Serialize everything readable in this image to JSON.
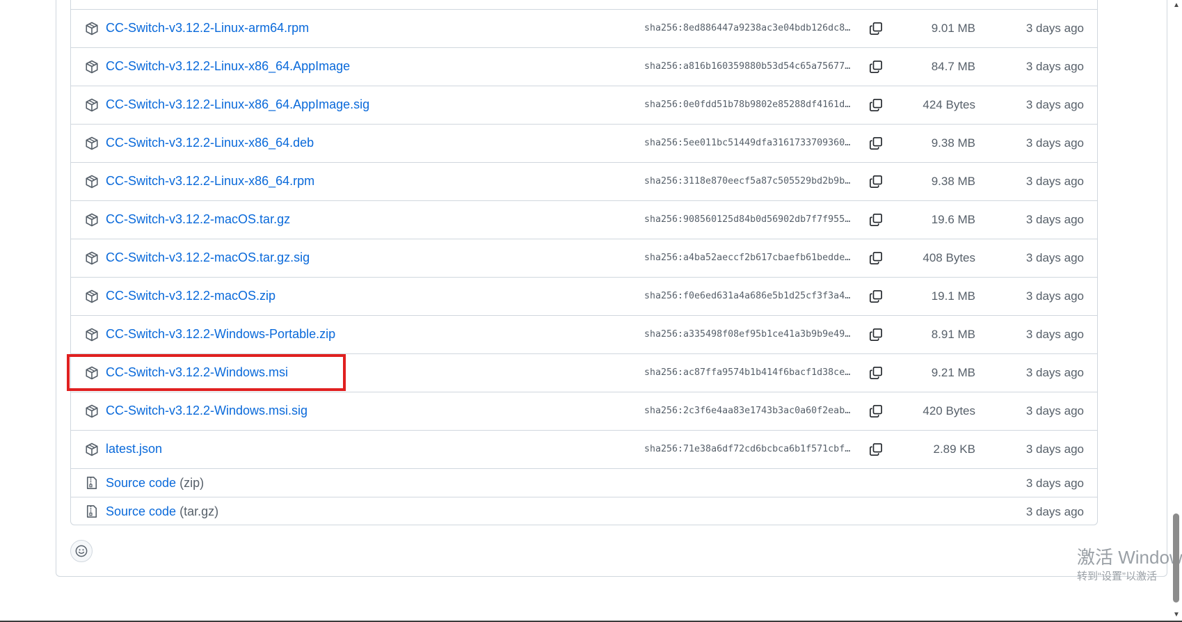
{
  "assets": [
    {
      "name": "CC-Switch-v3.12.2-Linux-arm64.rpm",
      "sha": "sha256:8ed886447a9238ac3e04bdb126dc8…",
      "size": "9.01 MB",
      "date": "3 days ago"
    },
    {
      "name": "CC-Switch-v3.12.2-Linux-x86_64.AppImage",
      "sha": "sha256:a816b160359880b53d54c65a75677…",
      "size": "84.7 MB",
      "date": "3 days ago"
    },
    {
      "name": "CC-Switch-v3.12.2-Linux-x86_64.AppImage.sig",
      "sha": "sha256:0e0fdd51b78b9802e85288df4161d…",
      "size": "424 Bytes",
      "date": "3 days ago"
    },
    {
      "name": "CC-Switch-v3.12.2-Linux-x86_64.deb",
      "sha": "sha256:5ee011bc51449dfa3161733709360…",
      "size": "9.38 MB",
      "date": "3 days ago"
    },
    {
      "name": "CC-Switch-v3.12.2-Linux-x86_64.rpm",
      "sha": "sha256:3118e870eecf5a87c505529bd2b9b…",
      "size": "9.38 MB",
      "date": "3 days ago"
    },
    {
      "name": "CC-Switch-v3.12.2-macOS.tar.gz",
      "sha": "sha256:908560125d84b0d56902db7f7f955…",
      "size": "19.6 MB",
      "date": "3 days ago"
    },
    {
      "name": "CC-Switch-v3.12.2-macOS.tar.gz.sig",
      "sha": "sha256:a4ba52aeccf2b617cbaefb61bedde…",
      "size": "408 Bytes",
      "date": "3 days ago"
    },
    {
      "name": "CC-Switch-v3.12.2-macOS.zip",
      "sha": "sha256:f0e6ed631a4a686e5b1d25cf3f3a4…",
      "size": "19.1 MB",
      "date": "3 days ago"
    },
    {
      "name": "CC-Switch-v3.12.2-Windows-Portable.zip",
      "sha": "sha256:a335498f08ef95b1ce41a3b9b9e49…",
      "size": "8.91 MB",
      "date": "3 days ago"
    },
    {
      "name": "CC-Switch-v3.12.2-Windows.msi",
      "sha": "sha256:ac87ffa9574b1b414f6bacf1d38ce…",
      "size": "9.21 MB",
      "date": "3 days ago"
    },
    {
      "name": "CC-Switch-v3.12.2-Windows.msi.sig",
      "sha": "sha256:2c3f6e4aa83e1743b3ac0a60f2eab…",
      "size": "420 Bytes",
      "date": "3 days ago"
    },
    {
      "name": "latest.json",
      "sha": "sha256:71e38a6df72cd6bcbca6b1f571cbf…",
      "size": "2.89 KB",
      "date": "3 days ago"
    }
  ],
  "source_code": [
    {
      "label": "Source code",
      "format": "(zip)",
      "date": "3 days ago"
    },
    {
      "label": "Source code",
      "format": "(tar.gz)",
      "date": "3 days ago"
    }
  ],
  "highlighted_asset": "CC-Switch-v3.12.2-Windows.msi",
  "watermark": {
    "title": "激活 Window",
    "subtitle": "转到“设置”以激活"
  },
  "colors": {
    "link": "#0969da",
    "muted": "#57606a",
    "border": "#d0d7de",
    "highlight": "#e02020"
  },
  "icons": {
    "asset": "package-icon",
    "source": "file-zip-icon",
    "copy": "copy-icon",
    "reaction": "smiley-icon"
  }
}
